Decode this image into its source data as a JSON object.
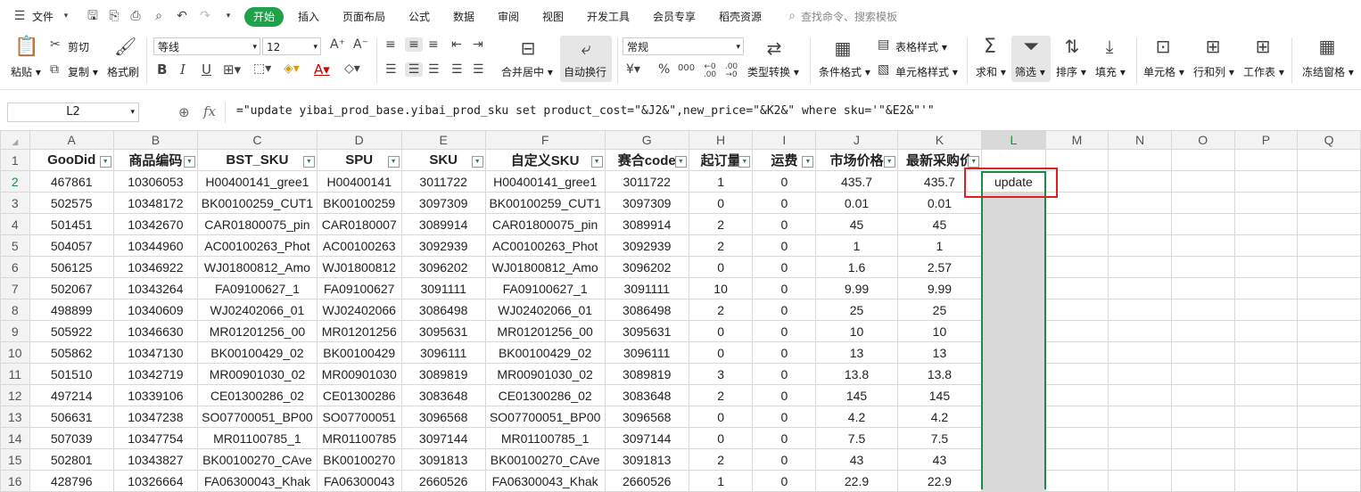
{
  "menubar": {
    "file": "文件",
    "tabs": [
      "开始",
      "插入",
      "页面布局",
      "公式",
      "数据",
      "审阅",
      "视图",
      "开发工具",
      "会员专享",
      "稻壳资源"
    ],
    "search_placeholder": "查找命令、搜索模板"
  },
  "ribbon": {
    "paste": "粘贴",
    "cut": "剪切",
    "copy": "复制",
    "format_painter": "格式刷",
    "font_name": "等线",
    "font_size": "12",
    "merge_center": "合并居中",
    "wrap_text": "自动换行",
    "number_format": "常规",
    "type_convert": "类型转换",
    "conditional_format": "条件格式",
    "table_style": "表格样式",
    "cell_style": "单元格样式",
    "sum": "求和",
    "filter": "筛选",
    "sort": "排序",
    "fill": "填充",
    "cell": "单元格",
    "row_col": "行和列",
    "worksheet": "工作表",
    "freeze": "冻结窗格",
    "currency_symbol": "¥",
    "percent": "%",
    "thousands": "000",
    "inc_decimal": "←0 .00",
    "dec_decimal": ".00 →0"
  },
  "formula": {
    "name_box": "L2",
    "fx": "fx",
    "content": "=\"update yibai_prod_base.yibai_prod_sku set product_cost=\"&J2&\",new_price=\"&K2&\" where sku='\"&E2&\"'\""
  },
  "sheet": {
    "columns": [
      "A",
      "B",
      "C",
      "D",
      "E",
      "F",
      "G",
      "H",
      "I",
      "J",
      "K",
      "L",
      "M",
      "N",
      "O",
      "P",
      "Q"
    ],
    "row_numbers": [
      "1",
      "2",
      "3",
      "4",
      "5",
      "6",
      "7",
      "8",
      "9",
      "10",
      "11",
      "12",
      "13",
      "14",
      "15",
      "16"
    ],
    "headers": [
      "GooDid",
      "商品编码",
      "BST_SKU",
      "SPU",
      "SKU",
      "自定义SKU",
      "赛合code",
      "起订量",
      "运费",
      "市场价格",
      "最新采购价"
    ],
    "rows": [
      [
        "467861",
        "10306053",
        "H00400141_gree1",
        "H00400141",
        "3011722",
        "H00400141_gree1",
        "3011722",
        "1",
        "0",
        "435.7",
        "435.7",
        "update"
      ],
      [
        "502575",
        "10348172",
        "BK00100259_CUT1",
        "BK00100259",
        "3097309",
        "BK00100259_CUT1",
        "3097309",
        "0",
        "0",
        "0.01",
        "0.01",
        ""
      ],
      [
        "501451",
        "10342670",
        "CAR01800075_pin",
        "CAR0180007",
        "3089914",
        "CAR01800075_pin",
        "3089914",
        "2",
        "0",
        "45",
        "45",
        ""
      ],
      [
        "504057",
        "10344960",
        "AC00100263_Phot",
        "AC00100263",
        "3092939",
        "AC00100263_Phot",
        "3092939",
        "2",
        "0",
        "1",
        "1",
        ""
      ],
      [
        "506125",
        "10346922",
        "WJ01800812_Amo",
        "WJ01800812",
        "3096202",
        "WJ01800812_Amo",
        "3096202",
        "0",
        "0",
        "1.6",
        "2.57",
        ""
      ],
      [
        "502067",
        "10343264",
        "FA09100627_1",
        "FA09100627",
        "3091111",
        "FA09100627_1",
        "3091111",
        "10",
        "0",
        "9.99",
        "9.99",
        ""
      ],
      [
        "498899",
        "10340609",
        "WJ02402066_01",
        "WJ02402066",
        "3086498",
        "WJ02402066_01",
        "3086498",
        "2",
        "0",
        "25",
        "25",
        ""
      ],
      [
        "505922",
        "10346630",
        "MR01201256_00",
        "MR01201256",
        "3095631",
        "MR01201256_00",
        "3095631",
        "0",
        "0",
        "10",
        "10",
        ""
      ],
      [
        "505862",
        "10347130",
        "BK00100429_02",
        "BK00100429",
        "3096111",
        "BK00100429_02",
        "3096111",
        "0",
        "0",
        "13",
        "13",
        ""
      ],
      [
        "501510",
        "10342719",
        "MR00901030_02",
        "MR00901030",
        "3089819",
        "MR00901030_02",
        "3089819",
        "3",
        "0",
        "13.8",
        "13.8",
        ""
      ],
      [
        "497214",
        "10339106",
        "CE01300286_02",
        "CE01300286",
        "3083648",
        "CE01300286_02",
        "3083648",
        "2",
        "0",
        "145",
        "145",
        ""
      ],
      [
        "506631",
        "10347238",
        "SO07700051_BP00",
        "SO07700051",
        "3096568",
        "SO07700051_BP00",
        "3096568",
        "0",
        "0",
        "4.2",
        "4.2",
        ""
      ],
      [
        "507039",
        "10347754",
        "MR01100785_1",
        "MR01100785",
        "3097144",
        "MR01100785_1",
        "3097144",
        "0",
        "0",
        "7.5",
        "7.5",
        ""
      ],
      [
        "502801",
        "10343827",
        "BK00100270_CAve",
        "BK00100270",
        "3091813",
        "BK00100270_CAve",
        "3091813",
        "2",
        "0",
        "43",
        "43",
        ""
      ],
      [
        "428796",
        "10326664",
        "FA06300043_Khak",
        "FA06300043",
        "2660526",
        "FA06300043_Khak",
        "2660526",
        "1",
        "0",
        "22.9",
        "22.9",
        ""
      ]
    ]
  },
  "colors": {
    "accent": "#1fa24a",
    "selection_border": "#1e8a48",
    "highlight_box": "#e02020",
    "selected_column": "#d9d9d9"
  }
}
